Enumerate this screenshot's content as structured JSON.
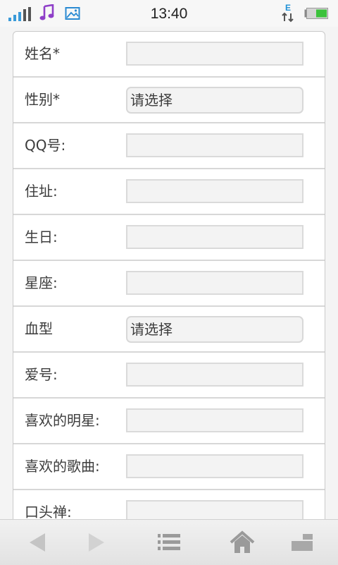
{
  "status_bar": {
    "time": "13:40",
    "icons": [
      "signal-icon",
      "music-icon",
      "image-icon",
      "data-e-icon",
      "battery-icon"
    ],
    "data_network_label": "E",
    "accent_color": "#3a9ad9",
    "battery_color": "#3cc23c"
  },
  "form": {
    "fields": [
      {
        "label": "姓名*",
        "type": "text",
        "value": ""
      },
      {
        "label": "性别*",
        "type": "select",
        "value": "请选择"
      },
      {
        "label": "QQ号:",
        "type": "text",
        "value": ""
      },
      {
        "label": "住址:",
        "type": "text",
        "value": ""
      },
      {
        "label": "生日:",
        "type": "text",
        "value": ""
      },
      {
        "label": "星座:",
        "type": "text",
        "value": ""
      },
      {
        "label": "血型",
        "type": "select",
        "value": "请选择"
      },
      {
        "label": "爱号:",
        "type": "text",
        "value": ""
      },
      {
        "label": "喜欢的明星:",
        "type": "text",
        "value": ""
      },
      {
        "label": "喜欢的歌曲:",
        "type": "text",
        "value": ""
      },
      {
        "label": "口头禅:",
        "type": "text",
        "value": ""
      }
    ]
  },
  "nav_bar": {
    "buttons": [
      "back-arrow-icon",
      "forward-arrow-icon",
      "menu-list-icon",
      "home-icon",
      "windows-icon"
    ]
  }
}
